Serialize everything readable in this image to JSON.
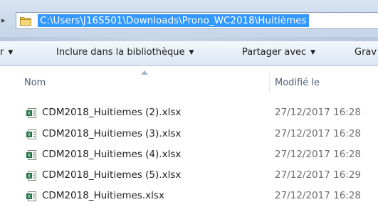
{
  "address_bar": {
    "path": "C:\\Users\\J16S501\\Downloads\\Prono_WC2018\\Huitièmes"
  },
  "toolbar": {
    "partial_left": "r",
    "include_in_library": "Inclure dans la bibliothèque",
    "share_with": "Partager avec",
    "burn_partial": "Grav"
  },
  "columns": {
    "name": "Nom",
    "modified": "Modifié le"
  },
  "files": [
    {
      "name": "CDM2018_Huitiemes (2).xlsx",
      "modified": "27/12/2017 16:28",
      "icon": "excel-file-icon"
    },
    {
      "name": "CDM2018_Huitiemes (3).xlsx",
      "modified": "27/12/2017 16:28",
      "icon": "excel-file-icon"
    },
    {
      "name": "CDM2018_Huitiemes (4).xlsx",
      "modified": "27/12/2017 16:28",
      "icon": "excel-file-icon"
    },
    {
      "name": "CDM2018_Huitiemes (5).xlsx",
      "modified": "27/12/2017 16:29",
      "icon": "excel-file-icon"
    },
    {
      "name": "CDM2018_Huitiemes.xlsx",
      "modified": "27/12/2017 16:28",
      "icon": "excel-file-icon"
    }
  ],
  "colors": {
    "selection": "#3399ff",
    "excel_green": "#217346"
  }
}
